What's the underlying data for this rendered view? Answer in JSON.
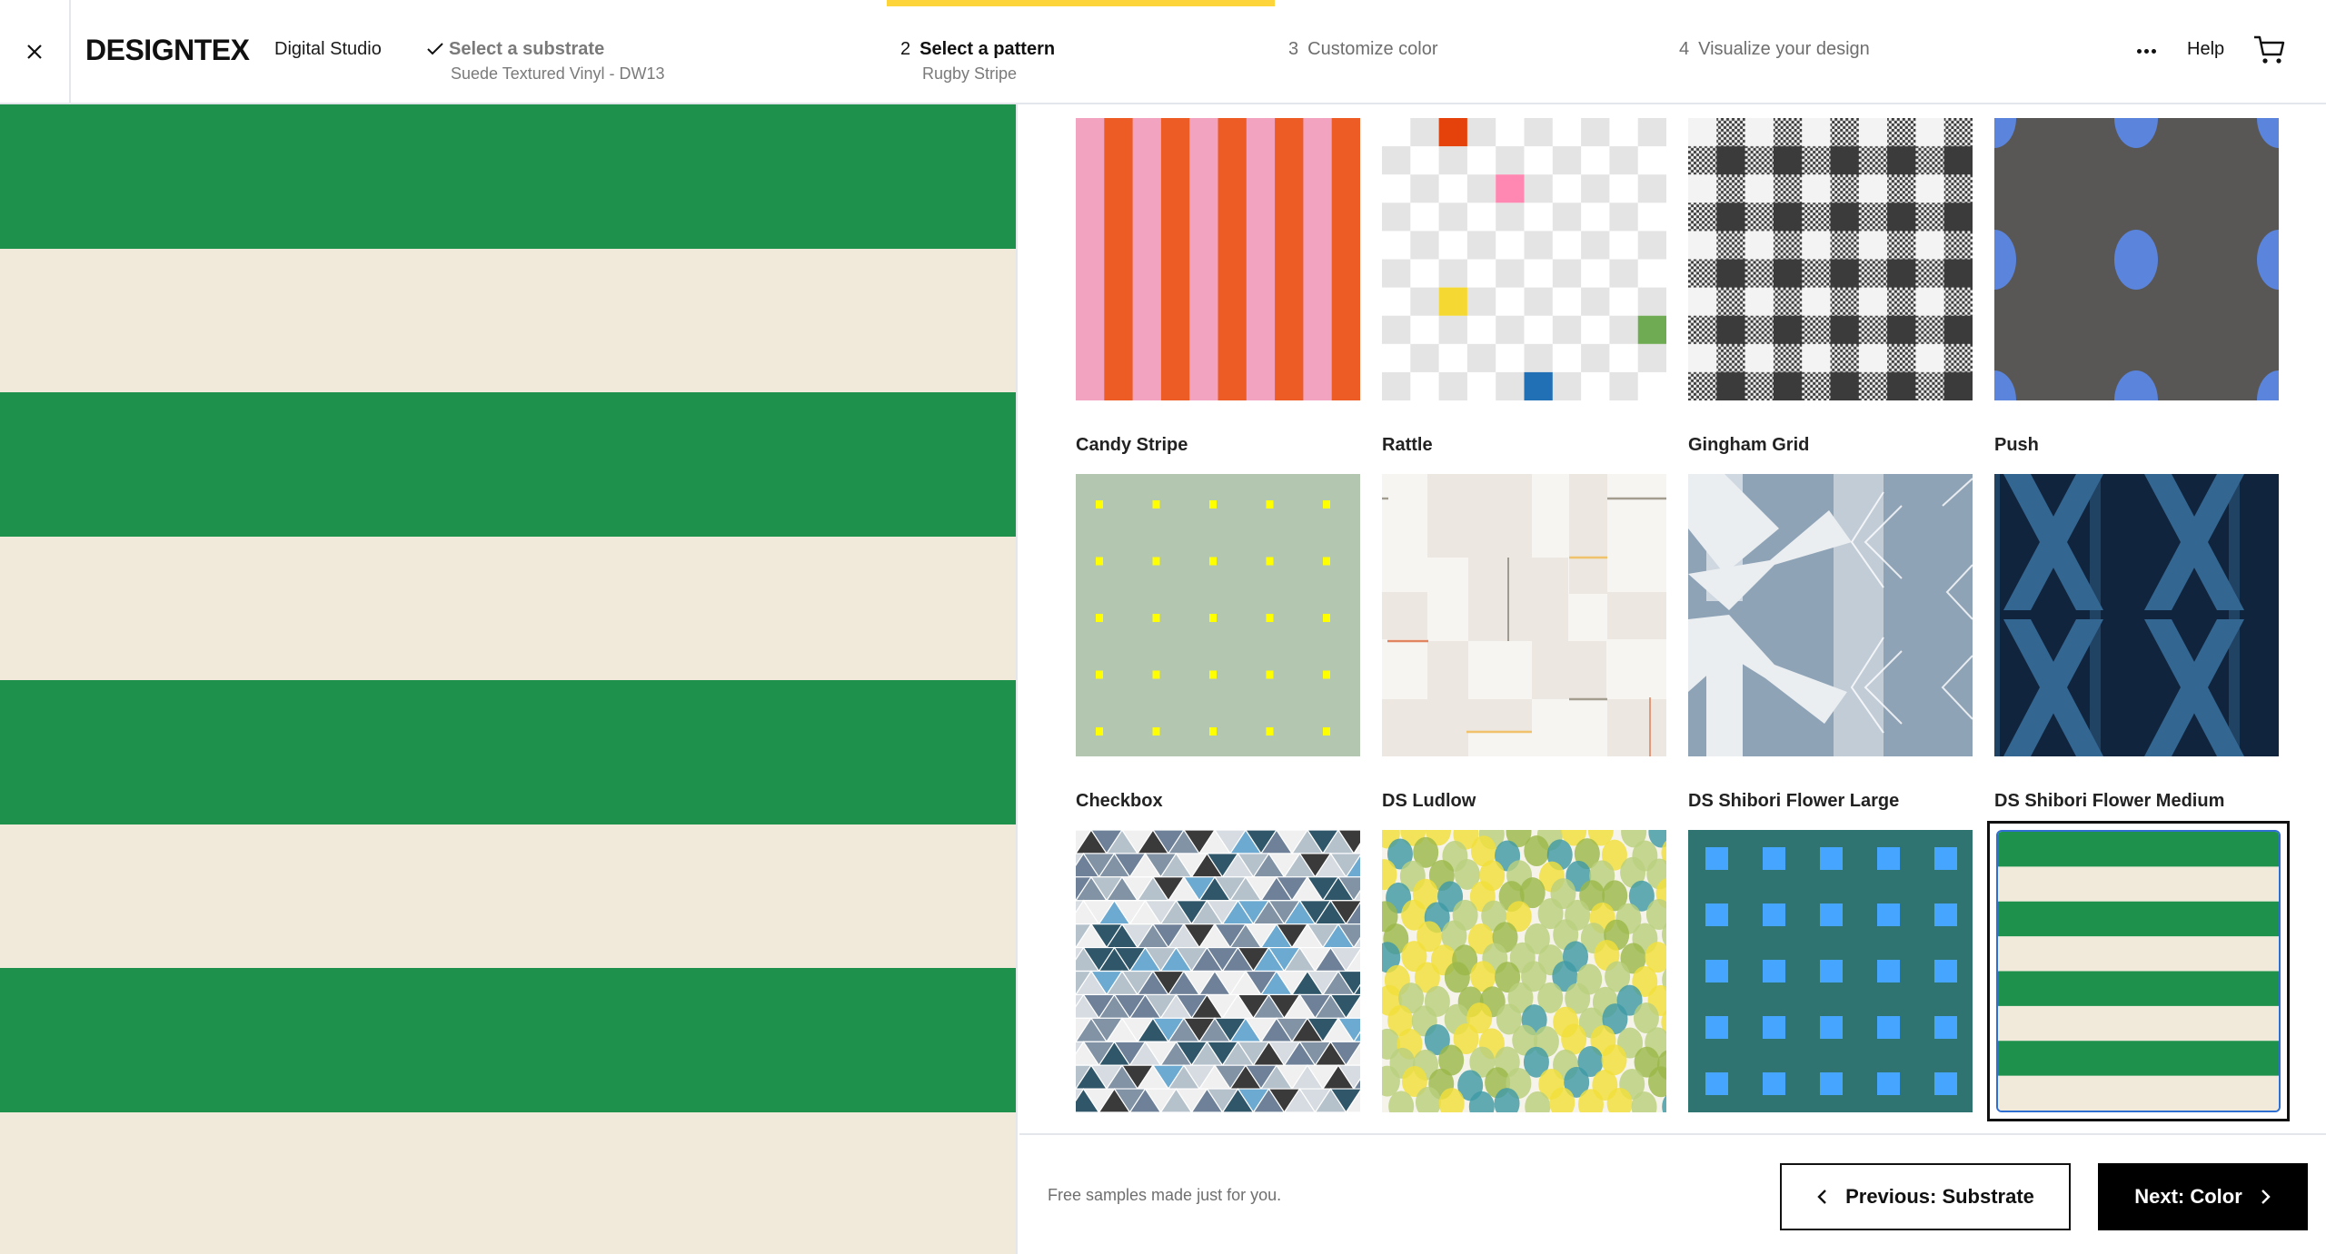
{
  "header": {
    "close_label": "Close",
    "logo": "DESIGNTEX",
    "app_name": "Digital Studio",
    "progress_step": 2,
    "progress_total": 4,
    "steps": [
      {
        "number": "",
        "title": "Select a substrate",
        "subtitle": "Suede Textured Vinyl - DW13",
        "state": "completed"
      },
      {
        "number": "2",
        "title": "Select a pattern",
        "subtitle": "Rugby Stripe",
        "state": "active"
      },
      {
        "number": "3",
        "title": "Customize color",
        "subtitle": "",
        "state": "upcoming"
      },
      {
        "number": "4",
        "title": "Visualize your design",
        "subtitle": "",
        "state": "upcoming"
      }
    ],
    "more_icon": "ellipsis-icon",
    "help_label": "Help",
    "cart_icon": "cart-icon",
    "accent_color": "#fdd43a"
  },
  "preview": {
    "pattern": "Rugby Stripe",
    "colors": {
      "primary": "#1e914c",
      "secondary": "#f1eadb"
    }
  },
  "patterns": [
    {
      "name": "Candy Stripe",
      "selected": false
    },
    {
      "name": "Rattle",
      "selected": false
    },
    {
      "name": "Gingham Grid",
      "selected": false
    },
    {
      "name": "Push",
      "selected": false
    },
    {
      "name": "Checkbox",
      "selected": false
    },
    {
      "name": "DS Ludlow",
      "selected": false
    },
    {
      "name": "DS Shibori Flower Large",
      "selected": false
    },
    {
      "name": "DS Shibori Flower Medium",
      "selected": false
    },
    {
      "name": "",
      "selected": false
    },
    {
      "name": "",
      "selected": false
    },
    {
      "name": "",
      "selected": false
    },
    {
      "name": "Rugby Stripe",
      "selected": true
    }
  ],
  "footer": {
    "note": "Free samples made just for you.",
    "previous_label": "Previous: Substrate",
    "next_label": "Next: Color"
  }
}
